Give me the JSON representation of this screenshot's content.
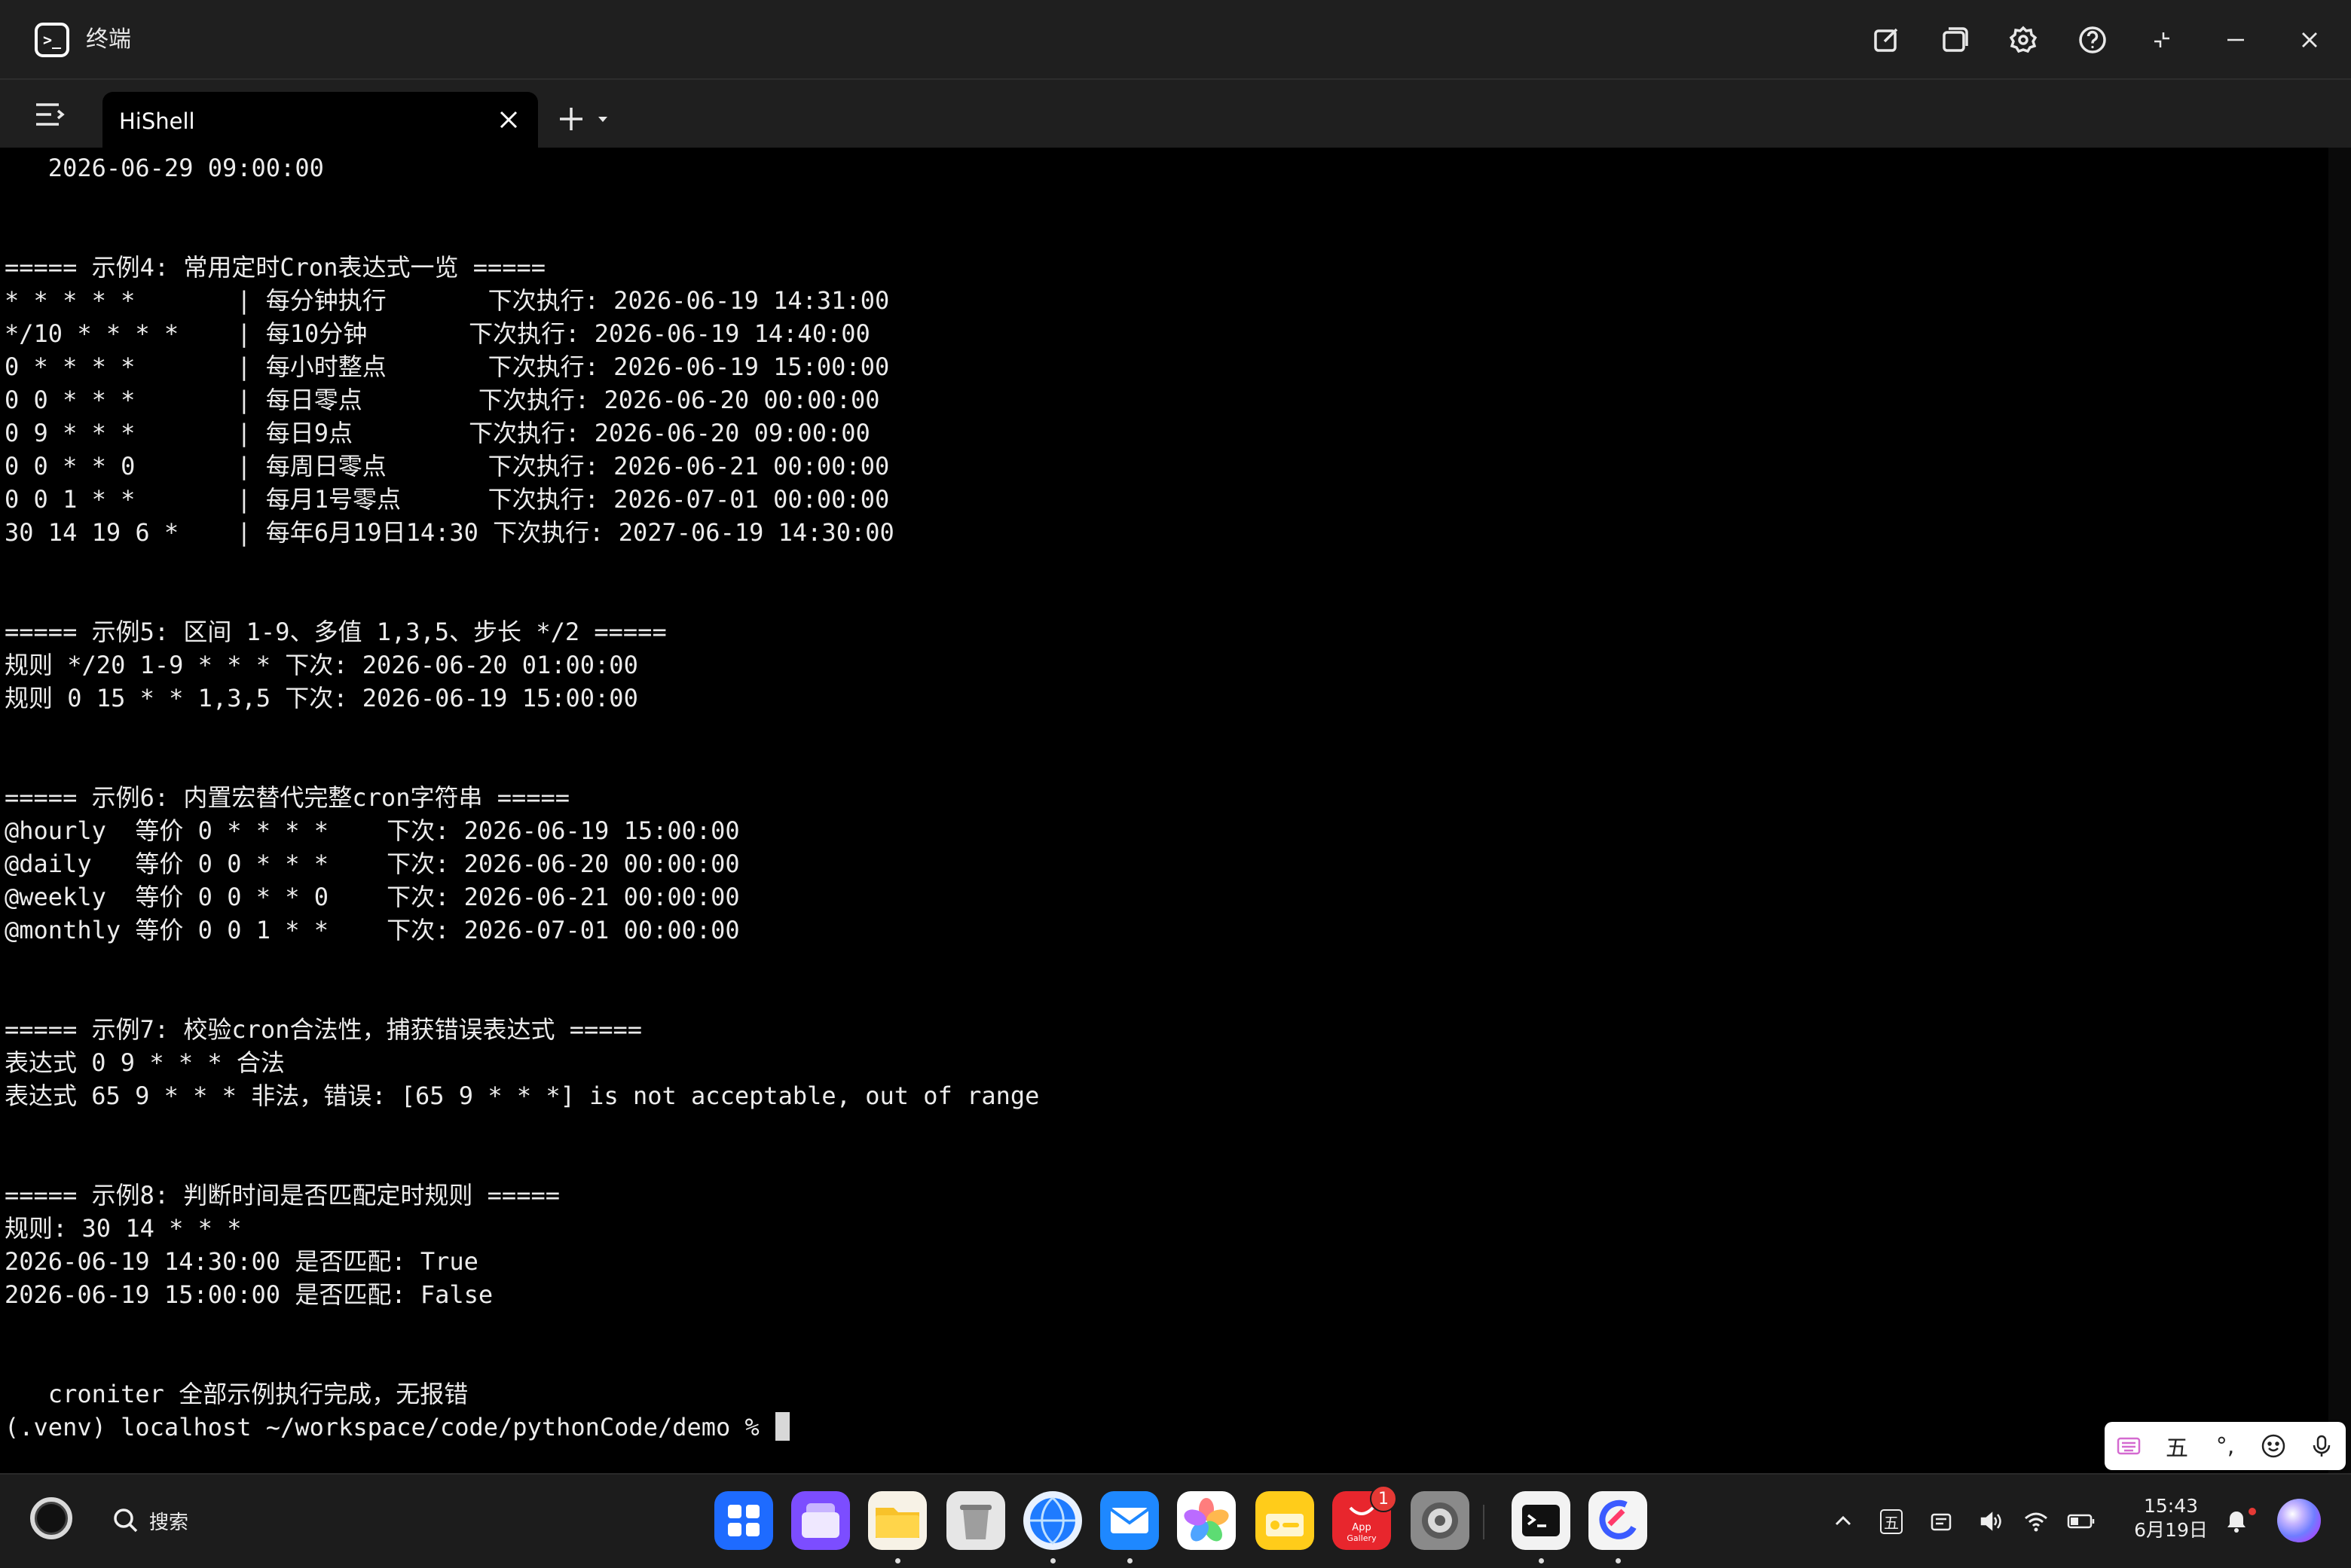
{
  "window": {
    "title": "终端"
  },
  "tabs": [
    {
      "label": "HiShell"
    }
  ],
  "terminal": {
    "lines": [
      "   2026-06-29 09:00:00",
      "",
      "",
      "===== 示例4: 常用定时Cron表达式一览 =====",
      "* * * * *       | 每分钟执行       下次执行: 2026-06-19 14:31:00",
      "*/10 * * * *    | 每10分钟       下次执行: 2026-06-19 14:40:00",
      "0 * * * *       | 每小时整点       下次执行: 2026-06-19 15:00:00",
      "0 0 * * *       | 每日零点        下次执行: 2026-06-20 00:00:00",
      "0 9 * * *       | 每日9点        下次执行: 2026-06-20 09:00:00",
      "0 0 * * 0       | 每周日零点       下次执行: 2026-06-21 00:00:00",
      "0 0 1 * *       | 每月1号零点      下次执行: 2026-07-01 00:00:00",
      "30 14 19 6 *    | 每年6月19日14:30 下次执行: 2027-06-19 14:30:00",
      "",
      "",
      "===== 示例5: 区间 1-9、多值 1,3,5、步长 */2 =====",
      "规则 */20 1-9 * * * 下次: 2026-06-20 01:00:00",
      "规则 0 15 * * 1,3,5 下次: 2026-06-19 15:00:00",
      "",
      "",
      "===== 示例6: 内置宏替代完整cron字符串 =====",
      "@hourly  等价 0 * * * *    下次: 2026-06-19 15:00:00",
      "@daily   等价 0 0 * * *    下次: 2026-06-20 00:00:00",
      "@weekly  等价 0 0 * * 0    下次: 2026-06-21 00:00:00",
      "@monthly 等价 0 0 1 * *    下次: 2026-07-01 00:00:00",
      "",
      "",
      "===== 示例7: 校验cron合法性，捕获错误表达式 =====",
      "表达式 0 9 * * * 合法",
      "表达式 65 9 * * * 非法，错误: [65 9 * * *] is not acceptable, out of range",
      "",
      "",
      "===== 示例8: 判断时间是否匹配定时规则 =====",
      "规则: 30 14 * * *",
      "2026-06-19 14:30:00 是否匹配: True",
      "2026-06-19 15:00:00 是否匹配: False",
      "",
      "",
      "   croniter 全部示例执行完成，无报错"
    ],
    "prompt": "(.venv) localhost ~/workspace/code/pythonCode/demo % "
  },
  "ime": {
    "mode_label": "五",
    "punct_label": "°,"
  },
  "taskbar": {
    "search_label": "搜索",
    "apps": [
      {
        "name": "launcher",
        "icon": "grid-icon",
        "running": false
      },
      {
        "name": "multitask",
        "icon": "stack-icon",
        "running": false
      },
      {
        "name": "files",
        "icon": "folder-icon",
        "running": true
      },
      {
        "name": "recycle-bin",
        "icon": "trash-icon",
        "running": false
      },
      {
        "name": "browser",
        "icon": "globe-icon",
        "running": true
      },
      {
        "name": "mail",
        "icon": "mail-icon",
        "running": true
      },
      {
        "name": "gallery",
        "icon": "flower-icon",
        "running": false
      },
      {
        "name": "notes",
        "icon": "notes-icon",
        "running": false
      },
      {
        "name": "app-gallery",
        "icon": "appgallery-icon",
        "running": false,
        "label": "App Gallery",
        "badge": "1"
      },
      {
        "name": "settings",
        "icon": "gear-icon",
        "running": false
      },
      {
        "name": "terminal",
        "icon": "terminal-icon",
        "running": true
      },
      {
        "name": "code-editor",
        "icon": "editor-icon",
        "running": true
      }
    ],
    "ime_indicator": "五",
    "clock": {
      "time": "15:43",
      "date": "6月19日"
    }
  },
  "colors": {
    "titlebar": "#1f1f1f",
    "terminal_bg": "#000000",
    "terminal_fg": "#ececec",
    "taskbar": "#1c1c1c",
    "badge": "#e53935"
  }
}
